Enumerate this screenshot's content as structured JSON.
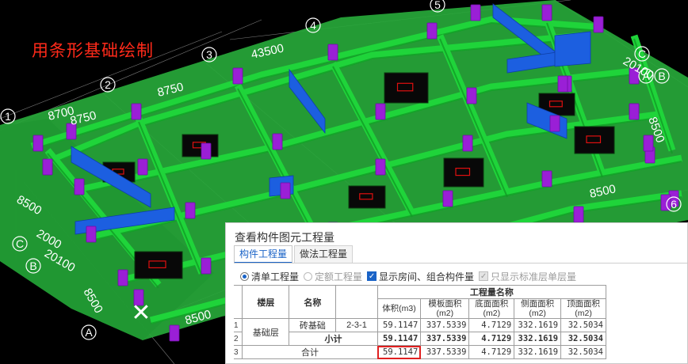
{
  "overlay": {
    "title": "用条形基础绘制",
    "close_glyph": "✕"
  },
  "axes": {
    "numbers": [
      "1",
      "2",
      "3",
      "4",
      "5",
      "6",
      "A",
      "B",
      "C",
      "B",
      "C",
      "A"
    ],
    "dimensions": [
      "43500",
      "20100",
      "8750",
      "8750",
      "8500",
      "8500",
      "8500",
      "8500",
      "8500",
      "2000",
      "20100",
      "8700"
    ]
  },
  "dialog": {
    "title": "查看构件图元工程量",
    "tabs": [
      "构件工程量",
      "做法工程量"
    ],
    "options": {
      "list_qty": "清单工程量",
      "quota_qty": "定额工程量",
      "show_rooms": "显示房间、组合构件量",
      "standard_floor": "只显示标准层单层量"
    },
    "table": {
      "headers": {
        "floor": "楼层",
        "name": "名称",
        "group": "工程量名称",
        "volume": "体积(m3)",
        "formwork": "模板面积(m2)",
        "bottom": "底面面积(m2)",
        "side": "侧面面积(m2)",
        "top": "顶面面积(m2)"
      },
      "rows": [
        {
          "n": "1",
          "floor": "基础层",
          "name": "砖基础",
          "code": "2-3-1",
          "volume": "59.1147",
          "formwork": "337.5339",
          "bottom": "4.7129",
          "side": "332.1619",
          "top": "32.5034"
        },
        {
          "n": "2",
          "label": "小计",
          "volume": "59.1147",
          "formwork": "337.5339",
          "bottom": "4.7129",
          "side": "332.1619",
          "top": "32.5034"
        },
        {
          "n": "3",
          "label": "合计",
          "volume": "59.1147",
          "formwork": "337.5339",
          "bottom": "4.7129",
          "side": "332.1619",
          "top": "32.5034"
        }
      ]
    }
  },
  "colors": {
    "slab": "#27a83a",
    "beam": "#1fd43a",
    "column": "#9a1fd6",
    "wall": "#1c5fe0",
    "title_red": "#ff2a1a",
    "tab_blue": "#1a63c7"
  }
}
